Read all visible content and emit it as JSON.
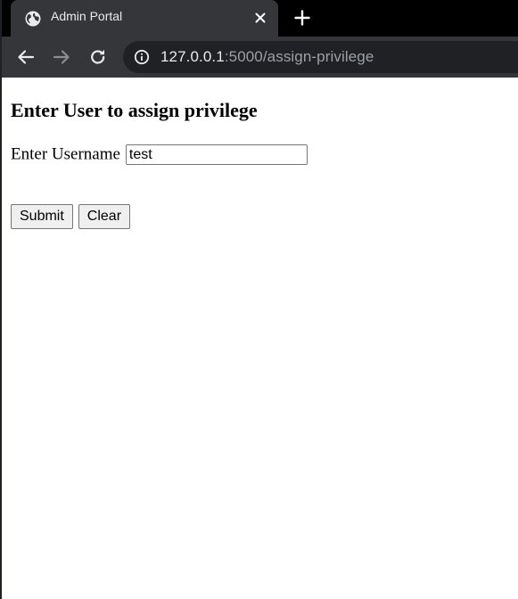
{
  "browser": {
    "tab_title": "Admin Portal",
    "url_host": "127.0.0.1",
    "url_rest": ":5000/assign-privilege",
    "icons": {
      "favicon": "globe-icon",
      "close": "close-icon",
      "new_tab": "plus-icon",
      "back": "back-arrow-icon",
      "forward": "forward-arrow-icon",
      "reload": "reload-icon",
      "site_info": "info-icon"
    }
  },
  "page": {
    "heading": "Enter User to assign privilege",
    "username_label": "Enter Username",
    "username_value": "test",
    "submit_label": "Submit",
    "clear_label": "Clear"
  },
  "colors": {
    "tabstrip_bg": "#000000",
    "toolbar_bg": "#35363a",
    "omnibox_bg": "#202124",
    "url_host": "#e8eaed",
    "url_rest": "#9aa0a6"
  }
}
